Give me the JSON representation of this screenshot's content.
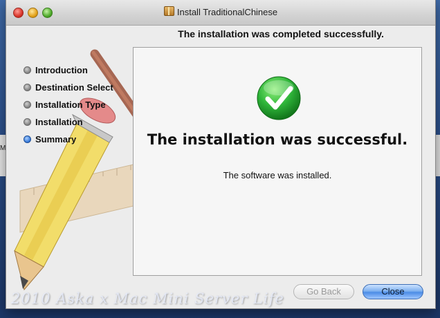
{
  "window": {
    "title": "Install TraditionalChinese"
  },
  "heading": "The installation was completed successfully.",
  "steps": [
    {
      "label": "Introduction",
      "active": false
    },
    {
      "label": "Destination Select",
      "active": false
    },
    {
      "label": "Installation Type",
      "active": false
    },
    {
      "label": "Installation",
      "active": false
    },
    {
      "label": "Summary",
      "active": true
    }
  ],
  "panel": {
    "title": "The installation was successful.",
    "message": "The software was installed."
  },
  "buttons": {
    "back": "Go Back",
    "close": "Close"
  },
  "desktop": {
    "left_window_fragment": "Ma"
  },
  "watermark": "2010 Aska x Mac Mini Server  Life",
  "colors": {
    "accent": "#4c8ce6",
    "success": "#2fb53a"
  }
}
